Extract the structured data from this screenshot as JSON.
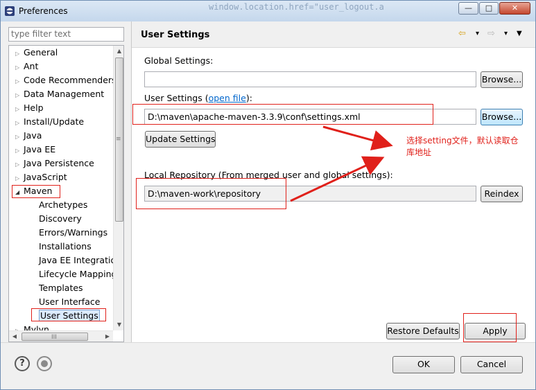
{
  "window": {
    "title": "Preferences",
    "background_code": "window.location.href=\"user_logout.a",
    "minimize": "—",
    "maximize": "□",
    "close": "✕"
  },
  "sidebar": {
    "filter_placeholder": "type filter text",
    "items": [
      {
        "label": "General",
        "expanded": false
      },
      {
        "label": "Ant",
        "expanded": false
      },
      {
        "label": "Code Recommenders",
        "expanded": false
      },
      {
        "label": "Data Management",
        "expanded": false
      },
      {
        "label": "Help",
        "expanded": false
      },
      {
        "label": "Install/Update",
        "expanded": false
      },
      {
        "label": "Java",
        "expanded": false
      },
      {
        "label": "Java EE",
        "expanded": false
      },
      {
        "label": "Java Persistence",
        "expanded": false
      },
      {
        "label": "JavaScript",
        "expanded": false
      },
      {
        "label": "Maven",
        "expanded": true
      },
      {
        "label": "Mylyn",
        "expanded": false
      }
    ],
    "maven_children": [
      "Archetypes",
      "Discovery",
      "Errors/Warnings",
      "Installations",
      "Java EE Integration",
      "Lifecycle Mapping",
      "Templates",
      "User Interface",
      "User Settings"
    ],
    "selected": "User Settings",
    "scroll_grip_v": "≡",
    "scroll_grip_h": "III"
  },
  "page": {
    "title": "User Settings",
    "nav_back": "⇦",
    "nav_forward": "⇨",
    "nav_dropdown": "▾",
    "view_menu": "▼",
    "global_settings_label": "Global Settings:",
    "global_settings_value": "",
    "user_settings_label_prefix": "User Settings (",
    "user_settings_link": "open file",
    "user_settings_label_suffix": "):",
    "user_settings_value": "D:\\maven\\apache-maven-3.3.9\\conf\\settings.xml",
    "browse_label": "Browse...",
    "update_settings_label": "Update Settings",
    "local_repo_label": "Local Repository (From merged user and global settings):",
    "local_repo_value": "D:\\maven-work\\repository",
    "reindex_label": "Reindex",
    "restore_defaults_label": "Restore Defaults",
    "apply_label": "Apply"
  },
  "annotation": {
    "note": "选择setting文件，默认读取仓库地址",
    "color": "#e0201a"
  },
  "footer": {
    "help_icon": "?",
    "ok_label": "OK",
    "cancel_label": "Cancel"
  }
}
